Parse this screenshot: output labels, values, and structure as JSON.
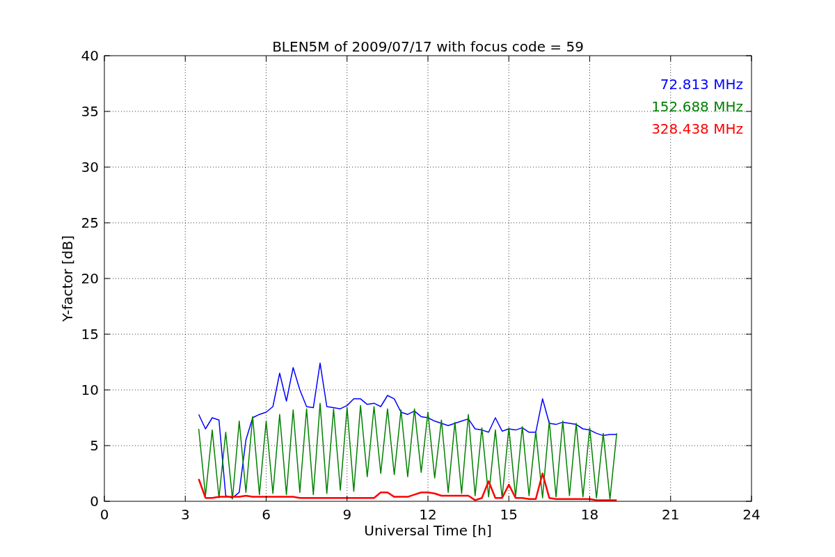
{
  "figure": {
    "chart_data": {
      "type": "line",
      "title": "BLEN5M of 2009/07/17 with focus code = 59",
      "xlabel": "Universal Time [h]",
      "ylabel": "Y-factor [dB]",
      "x": [
        3.5,
        3.75,
        4,
        4.25,
        4.5,
        4.75,
        5,
        5.25,
        5.5,
        5.75,
        6,
        6.25,
        6.5,
        6.75,
        7,
        7.25,
        7.5,
        7.75,
        8,
        8.25,
        8.5,
        8.75,
        9,
        9.25,
        9.5,
        9.75,
        10,
        10.25,
        10.5,
        10.75,
        11,
        11.25,
        11.5,
        11.75,
        12,
        12.25,
        12.5,
        12.75,
        13,
        13.25,
        13.5,
        13.75,
        14,
        14.25,
        14.5,
        14.75,
        15,
        15.25,
        15.5,
        15.75,
        16,
        16.25,
        16.5,
        16.75,
        17,
        17.25,
        17.5,
        17.75,
        18,
        18.25,
        18.5,
        18.75,
        19
      ],
      "series": [
        {
          "name": "72.813 MHz",
          "color": "#0000ff",
          "values": [
            7.8,
            6.5,
            7.5,
            7.3,
            0.5,
            0.3,
            0.8,
            5.5,
            7.5,
            7.8,
            8,
            8.5,
            11.5,
            9,
            12,
            10,
            8.5,
            8.4,
            12.4,
            8.5,
            8.4,
            8.3,
            8.6,
            9.2,
            9.2,
            8.7,
            8.8,
            8.5,
            9.5,
            9.2,
            8,
            7.8,
            8.1,
            7.6,
            7.5,
            7.2,
            7,
            6.8,
            7,
            7.2,
            7.4,
            6.5,
            6.4,
            6.2,
            7.5,
            6.3,
            6.5,
            6.4,
            6.6,
            6.2,
            6.2,
            9.2,
            7,
            6.9,
            7.1,
            7,
            6.9,
            6.5,
            6.4,
            6.1,
            5.9,
            6,
            6
          ]
        },
        {
          "name": "152.688 MHz",
          "color": "#008000",
          "values": [
            6.5,
            0.5,
            6.4,
            0.3,
            6.2,
            0.2,
            7.2,
            0.8,
            7.6,
            0.6,
            7.2,
            0.7,
            7.8,
            0.6,
            8.2,
            0.8,
            8.3,
            0.6,
            8.8,
            0.7,
            8.3,
            1,
            8.4,
            0.9,
            8.6,
            2.2,
            8.5,
            2.5,
            8.3,
            2.4,
            8.2,
            2.2,
            8.3,
            2.6,
            8,
            2.1,
            7.3,
            0.8,
            7.1,
            0.7,
            7.8,
            0.5,
            6.6,
            0.4,
            6.4,
            0.3,
            6.6,
            0.4,
            6.7,
            0.5,
            6.3,
            0.3,
            7.2,
            0.4,
            7.2,
            0.5,
            7,
            0.4,
            6.6,
            0.3,
            6.1,
            0.2,
            6.1
          ]
        },
        {
          "name": "328.438 MHz",
          "color": "#ff0000",
          "values": [
            2,
            0.3,
            0.3,
            0.4,
            0.4,
            0.4,
            0.4,
            0.5,
            0.4,
            0.4,
            0.4,
            0.4,
            0.4,
            0.4,
            0.4,
            0.3,
            0.3,
            0.3,
            0.3,
            0.3,
            0.3,
            0.3,
            0.3,
            0.3,
            0.3,
            0.3,
            0.3,
            0.8,
            0.8,
            0.4,
            0.4,
            0.4,
            0.6,
            0.8,
            0.8,
            0.7,
            0.5,
            0.5,
            0.5,
            0.5,
            0.5,
            0.1,
            0.3,
            1.8,
            0.3,
            0.3,
            1.5,
            0.3,
            0.3,
            0.2,
            0.2,
            2.5,
            0.3,
            0.2,
            0.2,
            0.2,
            0.2,
            0.2,
            0.2,
            0.1,
            0.1,
            0.1,
            0.1
          ]
        }
      ],
      "xlim": [
        0,
        24
      ],
      "ylim": [
        0,
        40
      ],
      "xticks": [
        0,
        3,
        6,
        9,
        12,
        15,
        18,
        21,
        24
      ],
      "yticks": [
        0,
        5,
        10,
        15,
        20,
        25,
        30,
        35,
        40
      ],
      "grid": true
    }
  }
}
